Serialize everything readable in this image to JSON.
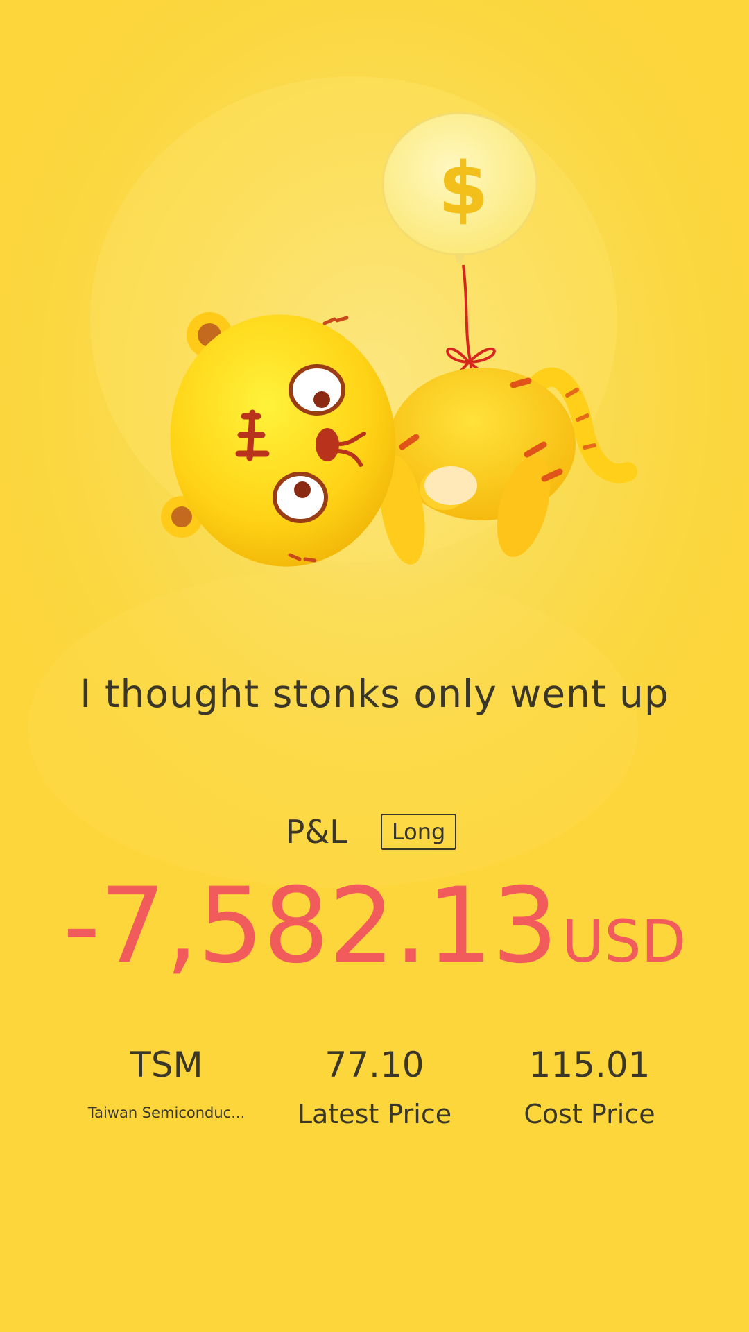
{
  "caption": "I thought stonks only went up",
  "pnl": {
    "label": "P&L",
    "direction_badge": "Long",
    "amount": "-7,582.13",
    "currency": "USD"
  },
  "stats": {
    "ticker": "TSM",
    "company": "Taiwan Semiconduc...",
    "latest_price_value": "77.10",
    "latest_price_label": "Latest Price",
    "cost_price_value": "115.01",
    "cost_price_label": "Cost Price"
  },
  "illustration": {
    "balloon_symbol": "$"
  },
  "colors": {
    "background": "#fbd740",
    "loss": "#f25b5b",
    "text": "#3a3628",
    "tiger_body": "#ffd21a",
    "tiger_stripes": "#c8321e"
  }
}
